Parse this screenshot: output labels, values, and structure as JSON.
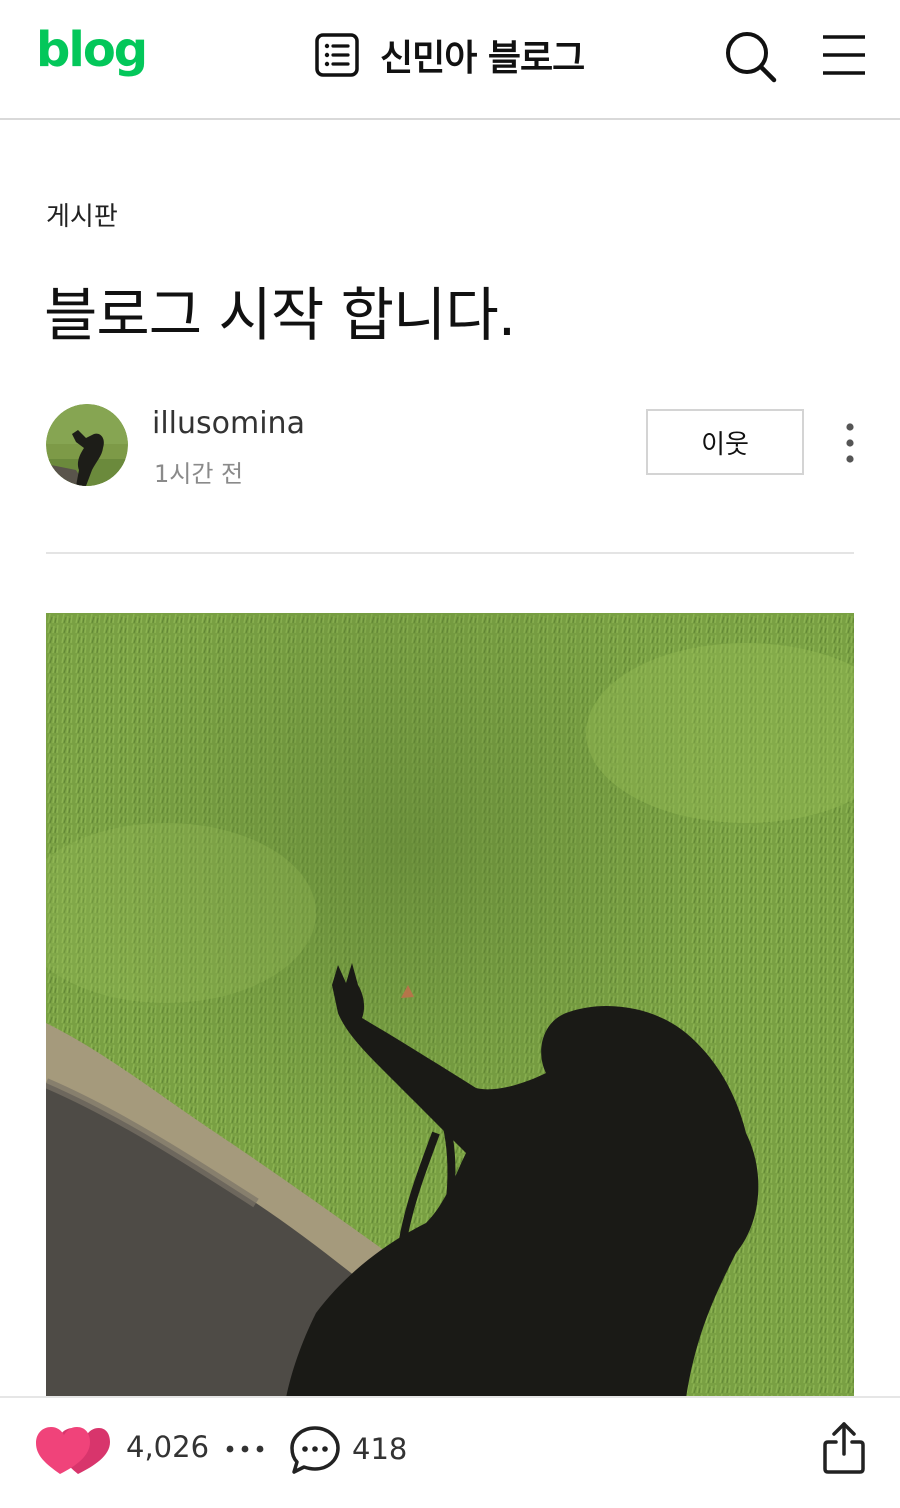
{
  "header": {
    "logo": "blog",
    "blog_title": "신민아 블로그",
    "icons": {
      "list": "list-icon",
      "search": "search-icon",
      "menu": "menu-icon"
    },
    "accent_color": "#03c75a"
  },
  "post": {
    "category": "게시판",
    "title": "블로그 시작 합니다.",
    "author": "illusomina",
    "posted_ago": "1시간 전",
    "neighbor_button": "이웃",
    "more_icon": "more-vertical-icon"
  },
  "photo": {
    "icon": "photo-shadow-on-grass"
  },
  "footer": {
    "like_count": "4,026",
    "comment_count": "418",
    "icons": {
      "like": "heart-icon",
      "more": "more-horizontal-icon",
      "comment": "comment-icon",
      "share": "share-icon"
    },
    "like_color": "#f0437a"
  }
}
